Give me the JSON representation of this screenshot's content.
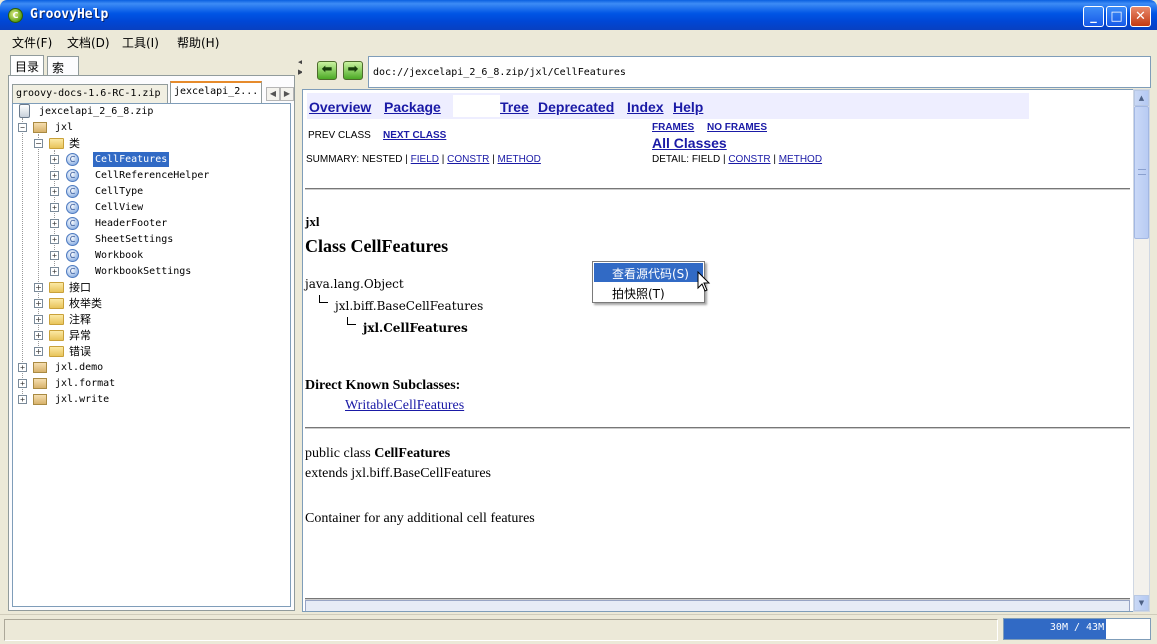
{
  "window": {
    "title": "GroovyHelp"
  },
  "menu": [
    "文件(F)",
    "文档(D)",
    "工具(I)",
    "帮助(H)"
  ],
  "left_tabs": {
    "toc": "目录",
    "index": "索引"
  },
  "doc_tabs": [
    "groovy-docs-1.6-RC-1.zip",
    "jexcelapi_2..."
  ],
  "tree": {
    "root": "jexcelapi_2_6_8.zip",
    "pkg_jxl": "jxl",
    "folder_classes": "类",
    "classes": [
      "CellFeatures",
      "CellReferenceHelper",
      "CellType",
      "CellView",
      "HeaderFooter",
      "SheetSettings",
      "Workbook",
      "WorkbookSettings"
    ],
    "folders": [
      "接口",
      "枚举类",
      "注释",
      "异常",
      "错误"
    ],
    "packages": [
      "jxl.demo",
      "jxl.format",
      "jxl.write"
    ],
    "class_icon_letter": "C"
  },
  "address": "doc://jexcelapi_2_6_8.zip/jxl/CellFeatures",
  "javadoc": {
    "nav": {
      "overview": "Overview",
      "package": "Package",
      "tree": "Tree",
      "deprecated": "Deprecated",
      "index": "Index",
      "help": "Help"
    },
    "prev_class": "PREV CLASS",
    "next_class": "NEXT CLASS",
    "frames": "FRAMES",
    "no_frames": "NO FRAMES",
    "all_classes": "All Classes",
    "summary_prefix": "SUMMARY: NESTED | ",
    "detail_prefix": "DETAIL: FIELD | ",
    "field": "FIELD",
    "constr": "CONSTR",
    "method": "METHOD",
    "sep": " | ",
    "package_name": "jxl",
    "class_heading": "Class CellFeatures",
    "hierarchy": [
      "java.lang.Object",
      "jxl.biff.BaseCellFeatures",
      "jxl.CellFeatures"
    ],
    "subclasses_heading": "Direct Known Subclasses:",
    "subclass": "WritableCellFeatures",
    "decl_prefix": "public class ",
    "decl_name": "CellFeatures",
    "extends_line": "extends jxl.biff.BaseCellFeatures",
    "description": "Container for any additional cell features"
  },
  "context_menu": [
    "查看源代码(S)",
    "拍快照(T)"
  ],
  "status": {
    "memory": "30M / 43M",
    "memory_used_fraction": 0.698
  }
}
